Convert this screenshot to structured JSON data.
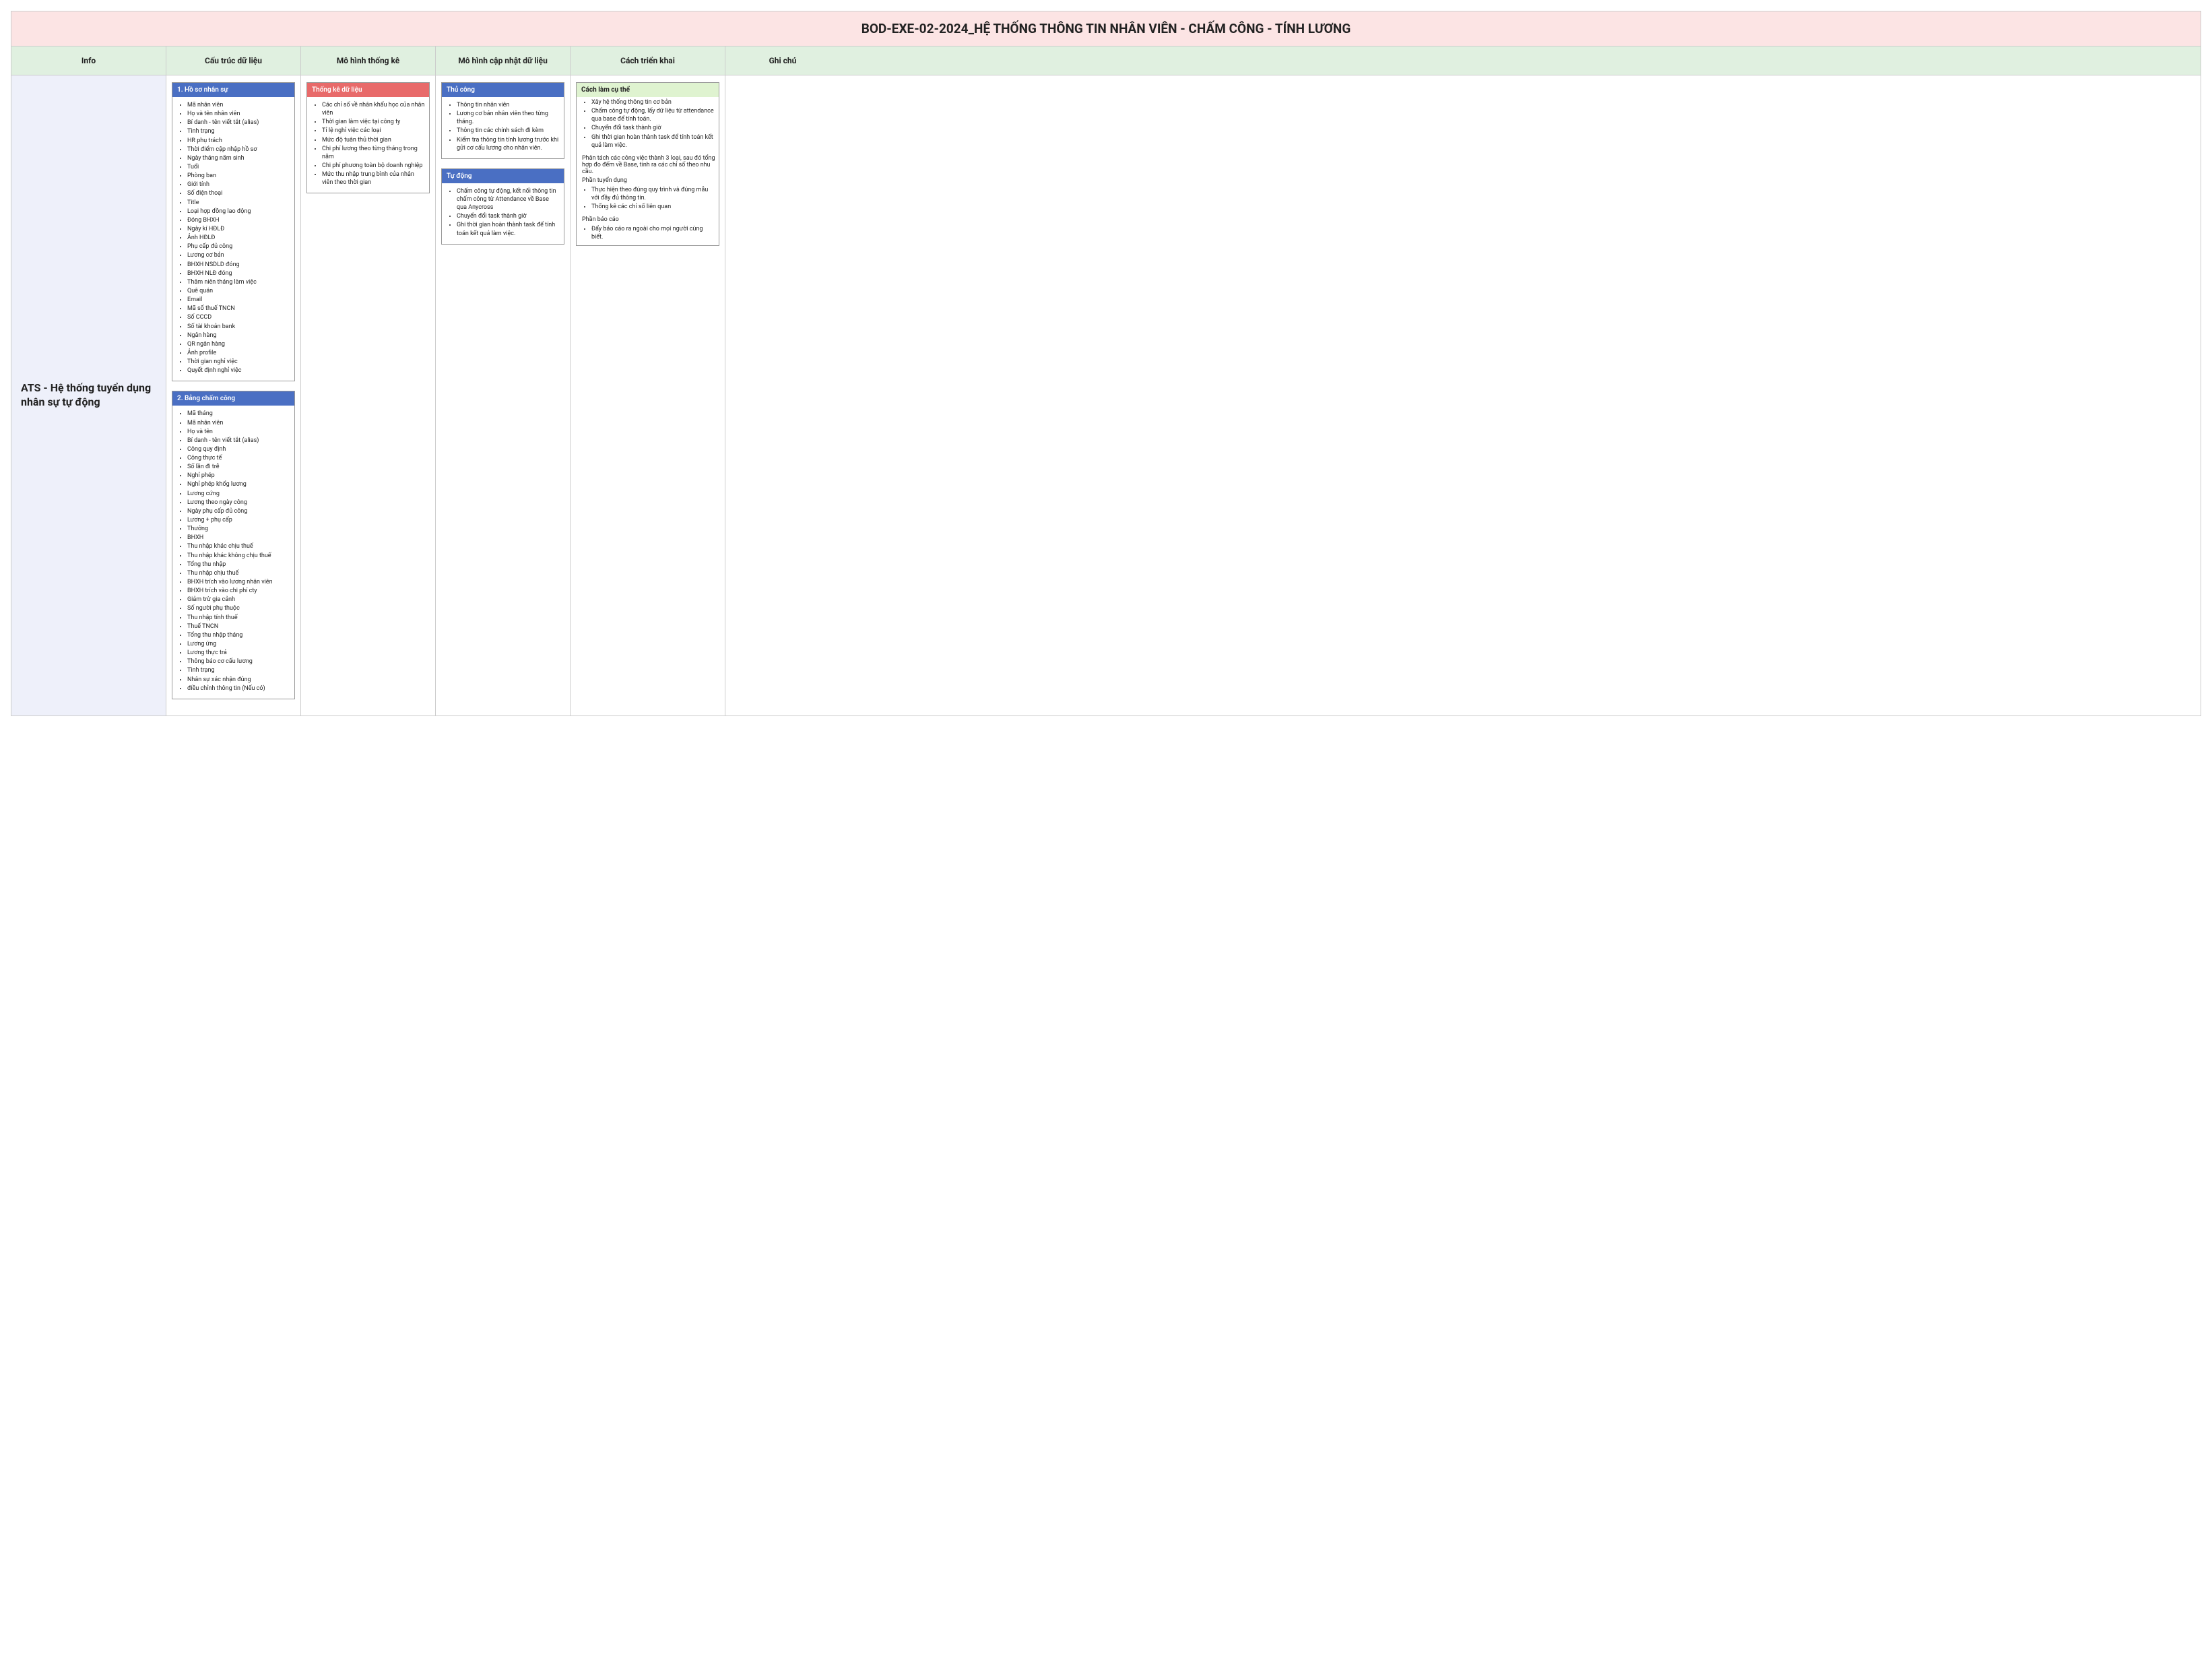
{
  "title": "BOD-EXE-02-2024_HỆ THỐNG THÔNG TIN NHÂN VIÊN - CHẤM CÔNG - TÍNH LƯƠNG",
  "headers": [
    "Info",
    "Cấu trúc dữ liệu",
    "Mô hình thống kê",
    "Mô hình cập nhật dữ liệu",
    "Cách triển khai",
    "Ghi chú"
  ],
  "info_text": "ATS - Hệ thống tuyển dụng nhân sự tự động",
  "struct1": {
    "title": "1. Hồ sơ nhân sự",
    "items": [
      "Mã nhân viên",
      "Họ và tên nhân viên",
      "Bí danh - tên viết tắt (alias)",
      "Tình trạng",
      "HR phụ trách",
      "Thời điểm cập nhập hồ sơ",
      "Ngày tháng năm sinh",
      "Tuổi",
      "Phòng ban",
      "Giới tính",
      "Số điện thoại",
      "Title",
      "Loại hợp đồng lao động",
      "Đóng BHXH",
      "Ngày kí HĐLĐ",
      "Ảnh HĐLĐ",
      "Phụ cấp đủ công",
      "Lương cơ bản",
      "BHXH NSDLD đóng",
      "BHXH NLĐ đóng",
      "Thâm niên tháng làm việc",
      "Quê quán",
      "Email",
      "Mã số thuế TNCN",
      "Số CCCD",
      "Số tài khoản bank",
      "Ngân hàng",
      "QR ngân hàng",
      "Ảnh profile",
      "Thời gian nghỉ việc",
      "Quyết định nghỉ việc"
    ]
  },
  "struct2": {
    "title": "2. Bảng chấm công",
    "items": [
      "Mã tháng",
      "Mã nhân viên",
      "Họ và tên",
      "Bí danh - tên viết tắt (alias)",
      "Công quy định",
      "Công thực tế",
      "Số lần đi trễ",
      "Nghỉ phép",
      "Nghỉ phép khổg lương",
      "Lương cứng",
      "Lương theo ngày công",
      "Ngày phụ cấp đủ công",
      "Lương + phụ cấp",
      "Thưởng",
      "BHXH",
      "Thu nhập khác chịu thuế",
      "Thu nhập khác không chịu thuế",
      "Tổng thu nhập",
      "Thu nhập chịu thuế",
      "BHXH trích vào lương nhân viên",
      "BHXH trích vào chi phí cty",
      "Giảm trừ gia cảnh",
      "Số người phụ thuộc",
      "Thu nhập tính thuế",
      "Thuế TNCN",
      "Tổng thu nhập tháng",
      "Lương ứng",
      "Lương thực trả",
      "Thông báo cơ cấu lương",
      "Tình trạng",
      "Nhân sự xác nhận đủng",
      "điều chỉnh thông tin (Nếu có)"
    ]
  },
  "stats": {
    "title": "Thống kê dữ liệu",
    "items": [
      "Các chỉ số về nhân khẩu học của nhân viên",
      "Thời gian làm việc tại công ty",
      "Tỉ lệ nghỉ việc các loại",
      "Mức độ tuân thủ thời gian",
      "Chi phí lương theo từng tháng trong năm",
      "Chi phí phương toàn bộ doanh nghiệp",
      "Mức thu nhập trung bình của nhân viên theo thời gian"
    ]
  },
  "manual": {
    "title": "Thủ công",
    "items": [
      "Thông tin nhân viên",
      "Lương cơ bản nhân viên theo từng tháng.",
      "Thông tin các chính sách đi kèm",
      "Kiểm tra thông tin tính lương trước khi gửi cơ cấu lương cho nhân viên."
    ]
  },
  "auto": {
    "title": "Tự động",
    "items": [
      "Chấm công tự động, kết nối thông tin chấm công từ Attendance về Base qua Anycross",
      "Chuyển đổi task thành giờ",
      "Ghi thời gian hoàn thành task để tính toán  kết quả làm việc."
    ]
  },
  "impl": {
    "title": "Cách làm cụ thể",
    "g1": [
      "Xây hệ thống thông tin cơ bản",
      "Chấm công tự động, lấy dữ liệu từ attendance qua base để tính toán.",
      "Chuyển đổi task thành giờ",
      "Ghi thời gian hoàn thành task để tính toán  kết quả làm việc."
    ],
    "g1_tail": "Phân tách các công việc thành 3 loại, sau đó tổng hợp đo đếm về Base, tính ra các chỉ số theo nhu cầu.",
    "g2_title": "Phần tuyển dụng",
    "g2": [
      "Thực hiện theo đúng quy trình và đúng mẫu với đầy đủ thông tin.",
      "Thống kê các chỉ số liên quan"
    ],
    "g3_title": "Phần báo cáo",
    "g3": [
      "Đẩy báo cáo ra ngoài cho mọi người cùng biết."
    ]
  }
}
